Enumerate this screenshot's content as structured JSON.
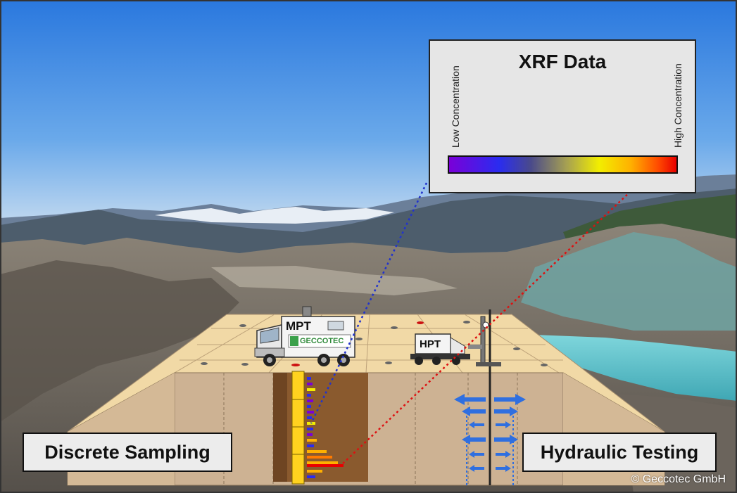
{
  "labels": {
    "discrete_sampling": "Discrete Sampling",
    "hydraulic_testing": "Hydraulic Testing",
    "mpt": "MPT",
    "hpt": "HPT",
    "truck_logo": "GECCOTEC"
  },
  "xrf_legend": {
    "title": "XRF Data",
    "low_label": "Low Concentration",
    "high_label": "High Concentration",
    "gradient_colors": [
      "#7a00d8",
      "#2a2cf0",
      "#4a4a8a",
      "#a8a250",
      "#f2ee00",
      "#ffb000",
      "#ff4a00",
      "#e80000"
    ]
  },
  "credit": "© Geccotec GmbH",
  "colors": {
    "sky_top": "#2f7fe0",
    "ground_top": "#f1d9a6",
    "ground_side": "#c9ae8e",
    "pond": "#5fc3cf",
    "arrow_blue": "#2f6fe0",
    "dotted_blue": "#2233cc",
    "dotted_red": "#dd1111"
  }
}
